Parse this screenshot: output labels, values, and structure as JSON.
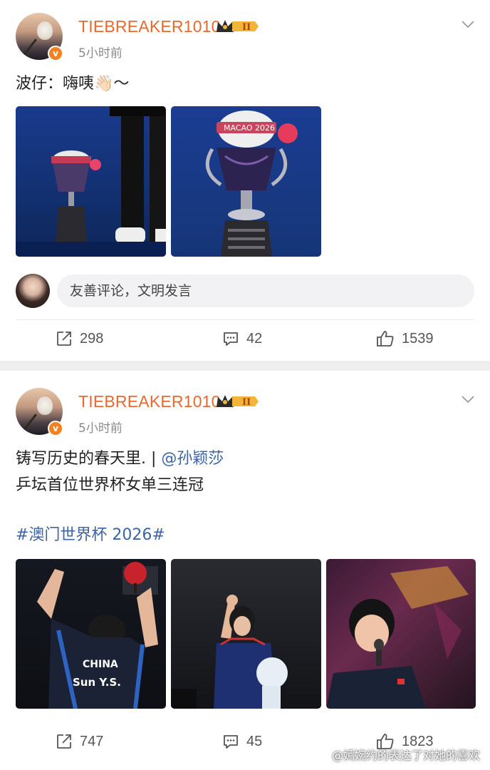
{
  "posts": [
    {
      "username": "TIEBREAKER1010",
      "badge_level": "II",
      "timestamp": "5小时前",
      "verified_mark": "v",
      "text_line1": "波仔：嗨咦👋🏻～",
      "photos": [
        "trophy-with-mascot-stage",
        "trophy-mascot-closeup"
      ],
      "comment_placeholder": "友善评论，文明发言",
      "repost_count": "298",
      "comment_count": "42",
      "like_count": "1539"
    },
    {
      "username": "TIEBREAKER1010",
      "badge_level": "II",
      "timestamp": "5小时前",
      "verified_mark": "v",
      "text_line1_main": "铸写历史的春天里. | ",
      "mention": "@孙颖莎",
      "text_line2": "乒坛首位世界杯女单三连冠",
      "hashtag": "#澳门世界杯 2026#",
      "photos": [
        "player-celebrating-back",
        "player-waving-mascot",
        "player-with-microphone"
      ],
      "photo1_jersey_text": "CHINA",
      "photo1_name_text": "Sun Y.S.",
      "repost_count": "747",
      "comment_count": "45",
      "like_count": "1823"
    }
  ],
  "trophy_ribbon_text": "MACAO 2026",
  "watermark": "@嫣婉约的表达了对她的喜欢",
  "colors": {
    "username": "#e9692c",
    "link": "#3d64a8",
    "badge_gold": "#f1b53a",
    "verified": "#f4811f",
    "background": "#efeff1"
  }
}
